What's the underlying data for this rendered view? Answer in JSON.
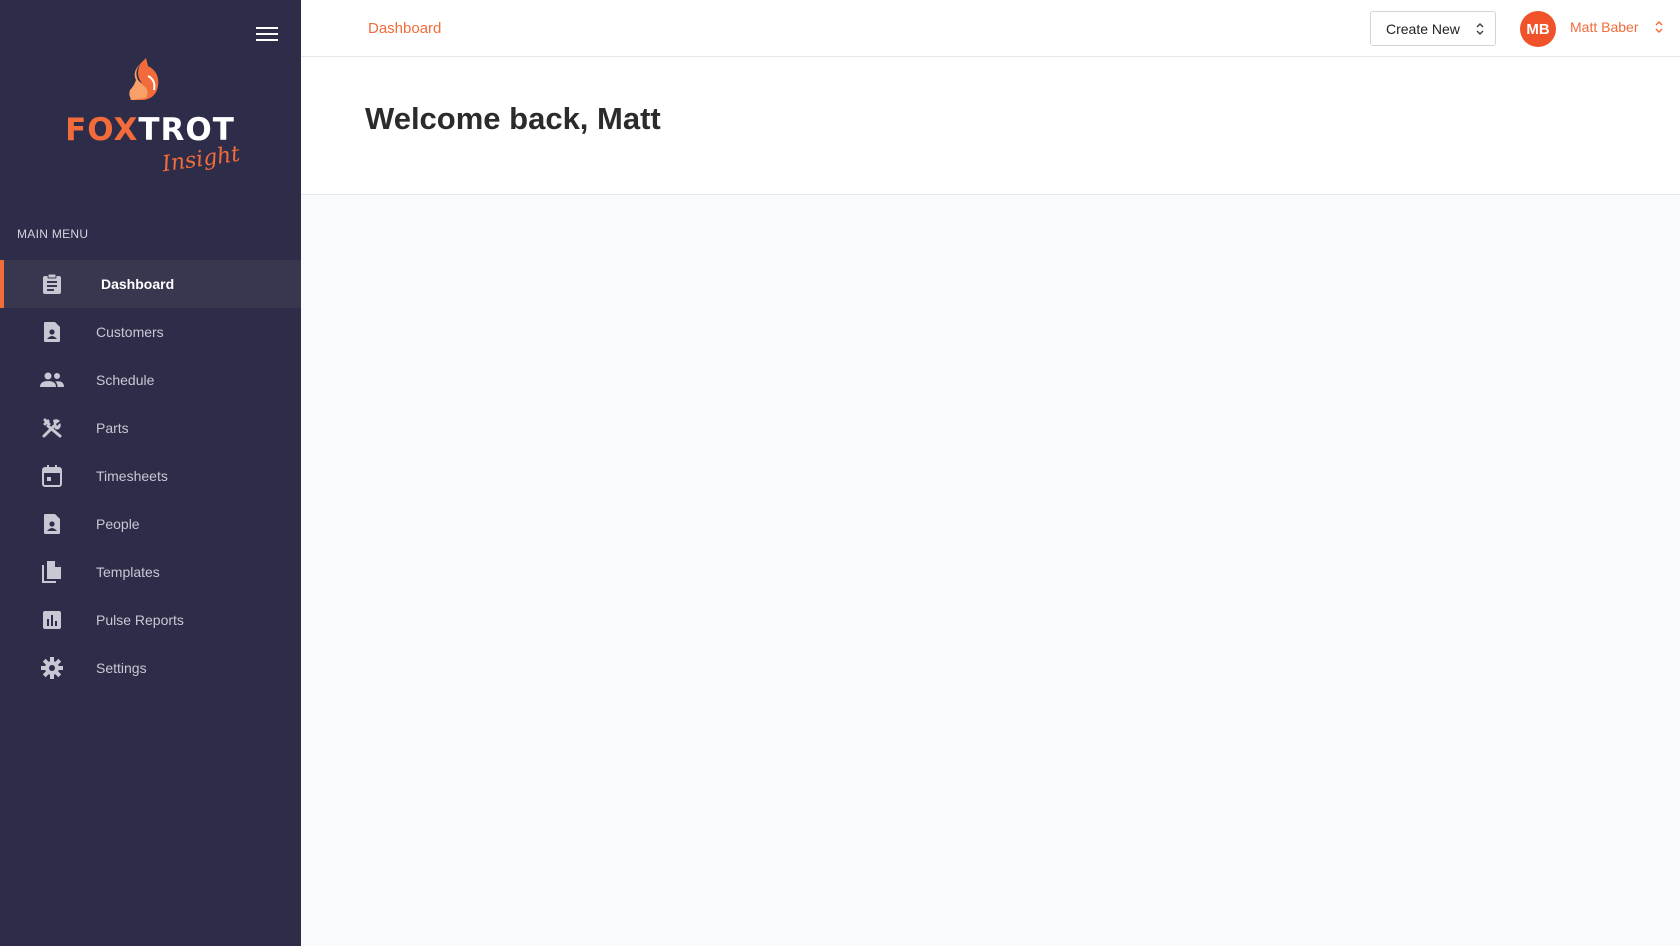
{
  "brand": {
    "fox": "FOX",
    "trot": "TROT",
    "sub": "Insight"
  },
  "sidebar": {
    "heading": "MAIN MENU",
    "items": [
      {
        "label": "Dashboard",
        "icon": "clipboard-icon",
        "active": true
      },
      {
        "label": "Customers",
        "icon": "contact-file-icon"
      },
      {
        "label": "Schedule",
        "icon": "people-icon"
      },
      {
        "label": "Parts",
        "icon": "tools-icon"
      },
      {
        "label": "Timesheets",
        "icon": "calendar-icon"
      },
      {
        "label": "People",
        "icon": "contact-file-icon"
      },
      {
        "label": "Templates",
        "icon": "copy-files-icon"
      },
      {
        "label": "Pulse Reports",
        "icon": "bar-chart-icon"
      },
      {
        "label": "Settings",
        "icon": "gear-icon"
      }
    ]
  },
  "topbar": {
    "breadcrumb": "Dashboard",
    "create_label": "Create New",
    "user_initials": "MB",
    "user_name": "Matt Baber"
  },
  "main": {
    "welcome": "Welcome back, Matt"
  },
  "colors": {
    "sidebar_bg": "#2d2c49",
    "accent": "#f26b3a",
    "avatar": "#f0522a"
  }
}
